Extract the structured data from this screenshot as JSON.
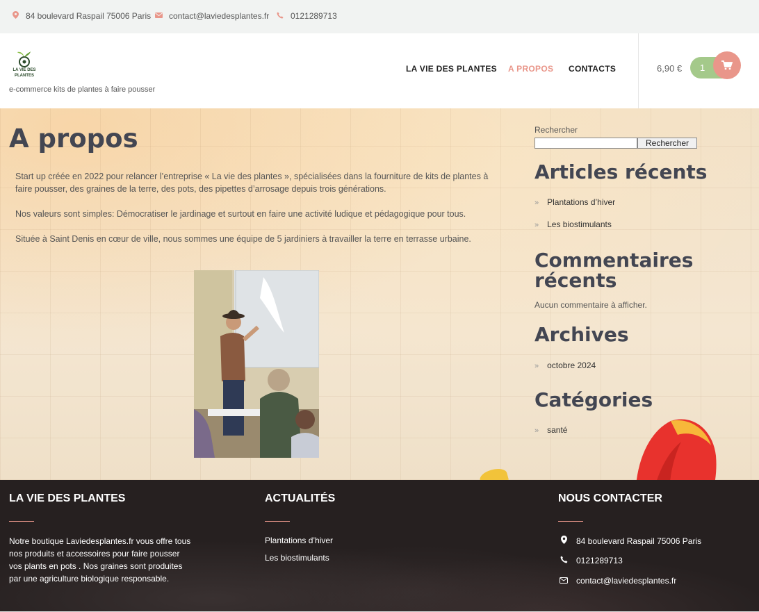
{
  "topbar": {
    "address": "84 boulevard Raspail 75006 Paris",
    "email": "contact@laviedesplantes.fr",
    "phone": "0121289713"
  },
  "header": {
    "logo_text": "LA VIE DES PLANTES",
    "tagline": "e-commerce kits de plantes à faire pousser",
    "nav": [
      "LA VIE DES PLANTES",
      "A PROPOS",
      "CONTACTS"
    ],
    "cart_total": "6,90 €",
    "cart_count": "1"
  },
  "main": {
    "title": "A propos",
    "paragraphs": [
      "Start up créée en 2022 pour relancer l’entreprise « La vie des plantes », spécialisées dans la fourniture de kits de plantes à faire pousser, des graines de la terre, des pots, des pipettes d’arrosage depuis trois générations.",
      "Nos valeurs sont simples: Démocratiser le jardinage et surtout en faire une activité ludique et pédagogique pour tous.",
      "Située à Saint Denis en cœur de ville, nous sommes une équipe de 5 jardiniers à travailler la terre en terrasse urbaine."
    ]
  },
  "sidebar": {
    "search_label": "Rechercher",
    "search_button": "Rechercher",
    "recent_articles_title": "Articles récents",
    "recent_articles": [
      "Plantations d’hiver",
      "Les biostimulants"
    ],
    "recent_comments_title_1": "Commentaires",
    "recent_comments_title_2": "récents",
    "no_comments": "Aucun commentaire à afficher.",
    "archives_title": "Archives",
    "archives": [
      "octobre 2024"
    ],
    "categories_title": "Catégories",
    "categories": [
      "santé"
    ]
  },
  "footer": {
    "col1_title": "LA VIE DES PLANTES",
    "col1_text": "Notre boutique Laviedesplantes.fr vous offre tous nos produits et accessoires pour faire pousser vos plants en pots . Nos graines sont produites par une agriculture biologique responsable.",
    "col2_title": "ACTUALITÉS",
    "col2_links": [
      "Plantations d’hiver",
      "Les biostimulants"
    ],
    "col3_title": "NOUS CONTACTER",
    "address": "84 boulevard Raspail 75006 Paris",
    "phone": "0121289713",
    "email": "contact@laviedesplantes.fr"
  },
  "colors": {
    "accent": "#e9968a",
    "cart_green": "#a4c98a",
    "heading": "#434652",
    "footer_bg": "#262020"
  }
}
